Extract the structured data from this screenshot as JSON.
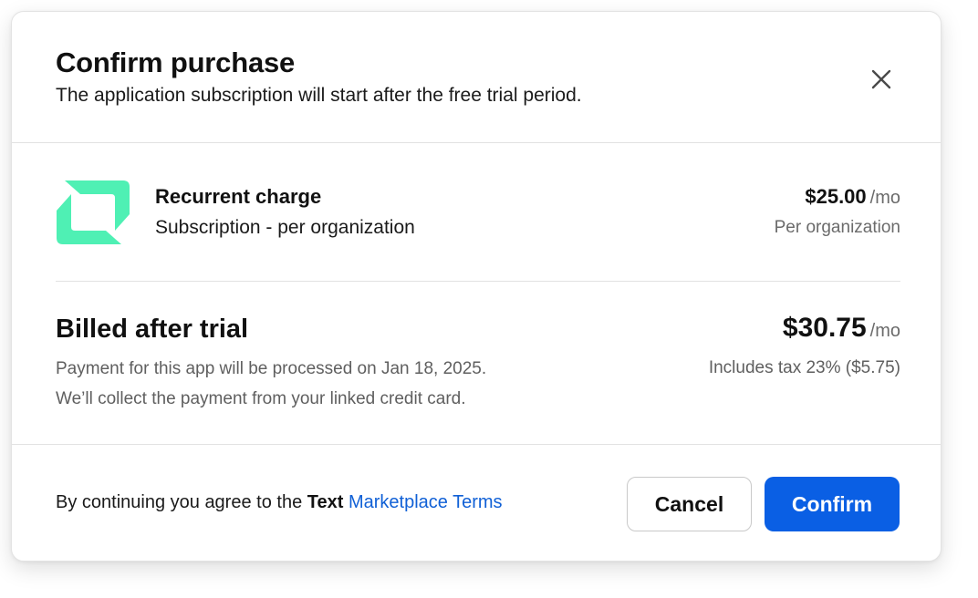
{
  "dialog": {
    "title": "Confirm purchase",
    "subtitle": "The application subscription will start after the free trial period.",
    "close_icon": "close-icon"
  },
  "charge": {
    "logo_icon": "app-logo-icon",
    "logo_color": "#4ff0b4",
    "label": "Recurrent charge",
    "description": "Subscription - per organization",
    "amount": "$25.00",
    "period": "/mo",
    "note": "Per organization"
  },
  "billing": {
    "title": "Billed after trial",
    "line1": "Payment for this app will be processed on Jan 18, 2025.",
    "line2": "We’ll collect the payment from your linked credit card.",
    "amount": "$30.75",
    "period": "/mo",
    "tax_note": "Includes tax 23% ($5.75)"
  },
  "footer": {
    "terms_prefix": "By continuing you agree to the",
    "terms_bold": "Text",
    "terms_link": "Marketplace Terms",
    "cancel_label": "Cancel",
    "confirm_label": "Confirm"
  },
  "colors": {
    "primary": "#0a5fe4",
    "link": "#1060d6",
    "brand_green": "#4ff0b4"
  }
}
